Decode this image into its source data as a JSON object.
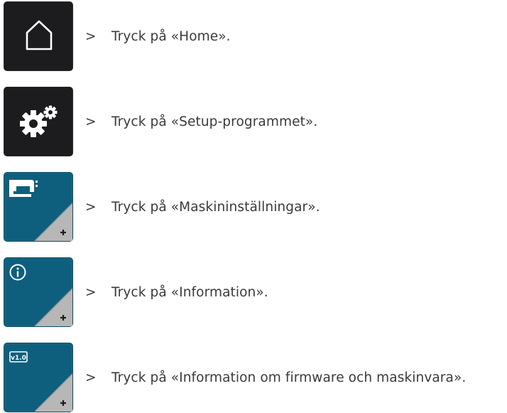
{
  "steps": [
    {
      "arrow": ">",
      "text": "Tryck på «Home».",
      "icon": "home-icon",
      "button_style": "dark"
    },
    {
      "arrow": ">",
      "text": "Tryck på «Setup-programmet».",
      "icon": "gears-icon",
      "button_style": "dark"
    },
    {
      "arrow": ">",
      "text": "Tryck på «Maskininställningar».",
      "icon": "sewing-machine-icon",
      "button_style": "blue"
    },
    {
      "arrow": ">",
      "text": "Tryck på «Information».",
      "icon": "info-icon",
      "button_style": "blue"
    },
    {
      "arrow": ">",
      "text": "Tryck på «Information om firmware och maskinvara».",
      "icon": "version-icon",
      "icon_label": "v1.0",
      "button_style": "blue"
    }
  ],
  "colors": {
    "dark_button": "#1c1c1e",
    "blue_button": "#0e5f7e",
    "text": "#3a3a3a"
  }
}
